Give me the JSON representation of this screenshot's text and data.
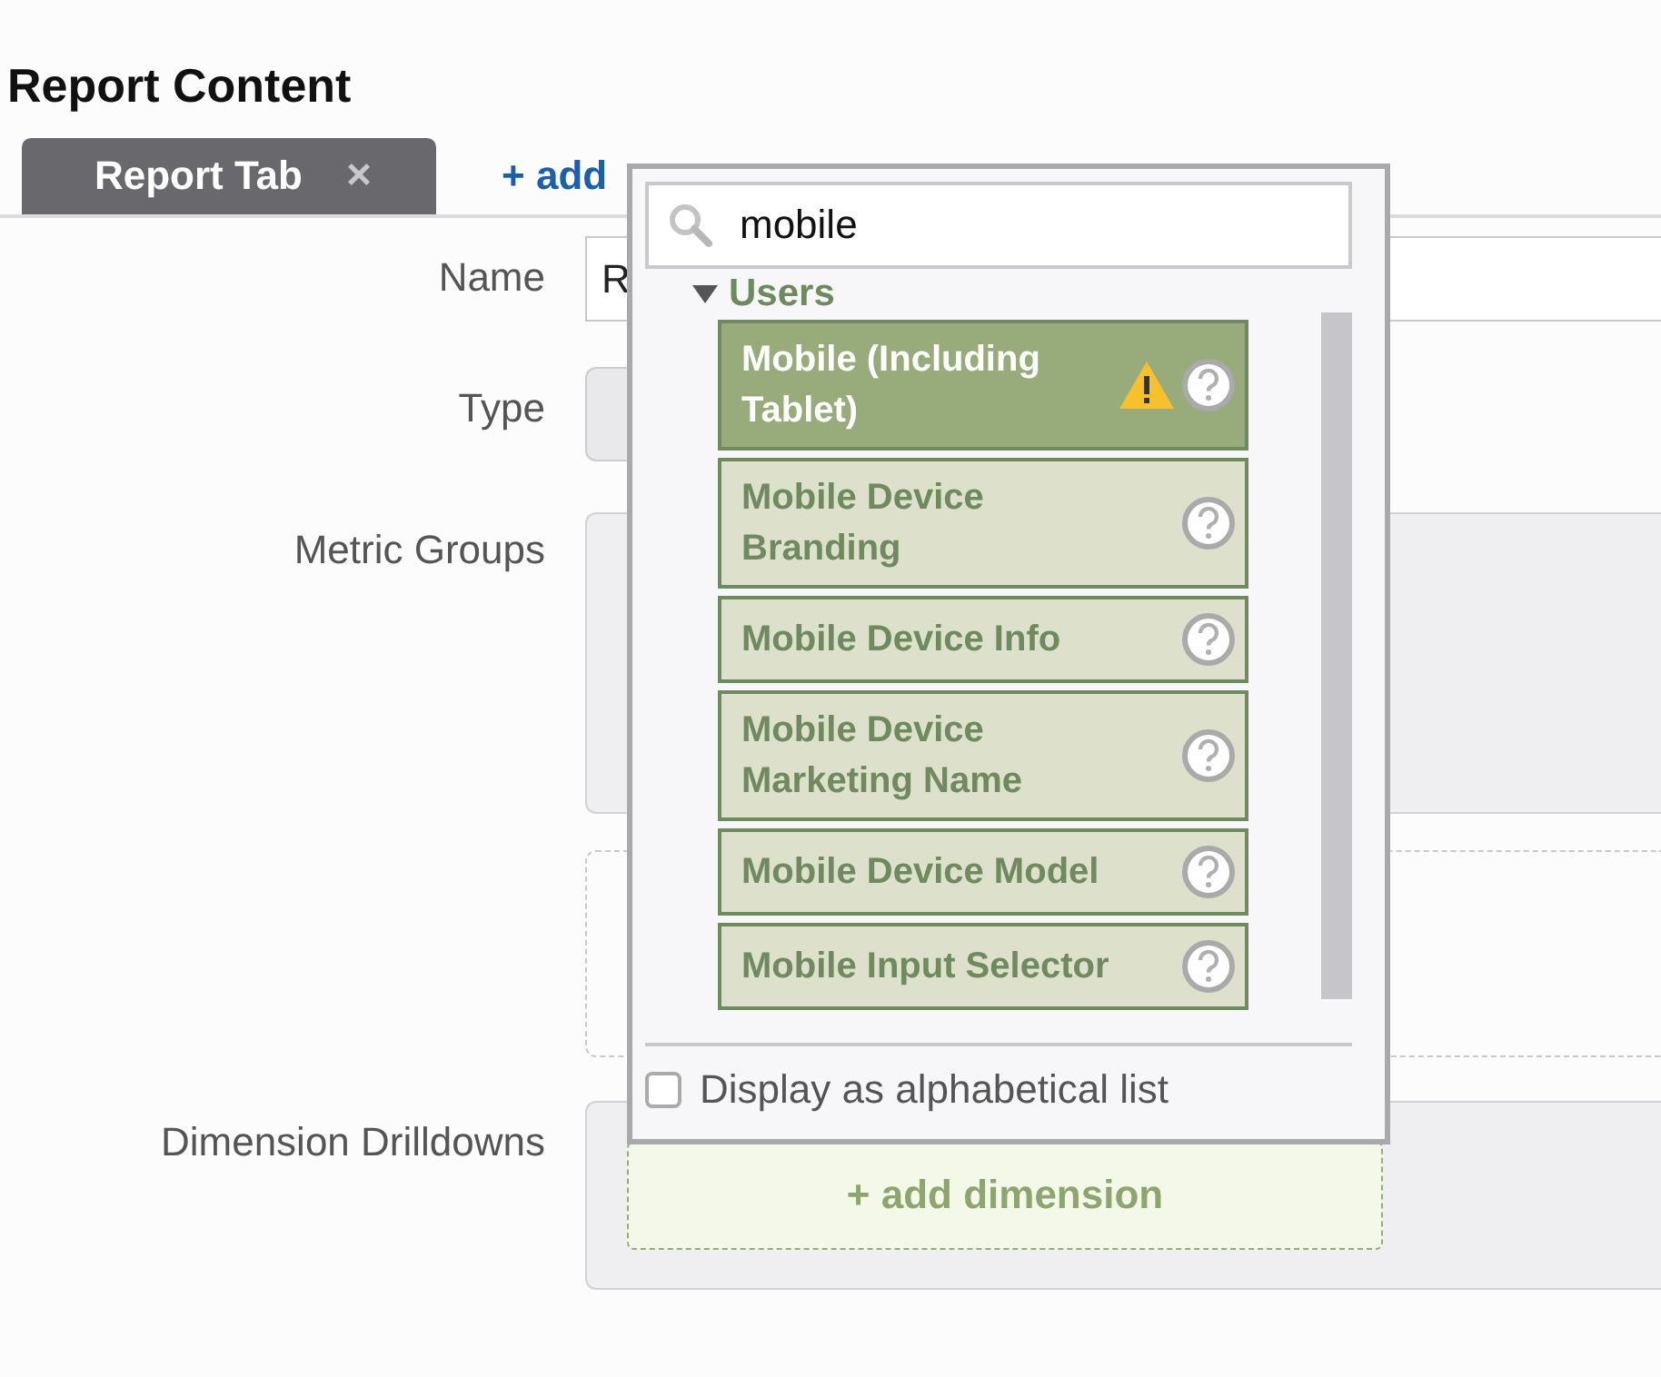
{
  "heading": "Report Content",
  "tabs": [
    {
      "label": "Report Tab",
      "close": "×",
      "selected": true
    }
  ],
  "add_tab": "+ add",
  "form": {
    "name_label": "Name",
    "name_value": "R",
    "type_label": "Type",
    "metric_groups_label": "Metric Groups",
    "dimension_label": "Dimension Drilldowns",
    "add_dimension": "+ add dimension"
  },
  "picker": {
    "search": {
      "value": "mobile"
    },
    "group": {
      "label": "Users",
      "expanded": true
    },
    "items": [
      {
        "label": "Mobile (Including Tablet)",
        "selected": true,
        "warning": true
      },
      {
        "label": "Mobile Device Branding",
        "selected": false,
        "warning": false
      },
      {
        "label": "Mobile Device Info",
        "selected": false,
        "warning": false
      },
      {
        "label": "Mobile Device Marketing Name",
        "selected": false,
        "warning": false
      },
      {
        "label": "Mobile Device Model",
        "selected": false,
        "warning": false
      },
      {
        "label": "Mobile Input Selector",
        "selected": false,
        "warning": false
      }
    ],
    "alphabetical": {
      "label": "Display as alphabetical list",
      "checked": false
    }
  }
}
